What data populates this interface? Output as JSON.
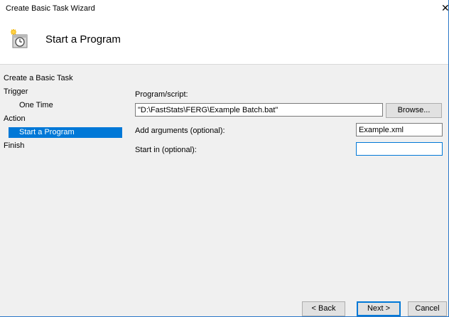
{
  "window": {
    "title": "Create Basic Task Wizard",
    "close_glyph": "✕"
  },
  "header": {
    "title": "Start a Program",
    "icon": "task-scheduler-clock-icon"
  },
  "steps": [
    {
      "label": "Create a Basic Task",
      "level": 0,
      "selected": false
    },
    {
      "label": "Trigger",
      "level": 0,
      "selected": false
    },
    {
      "label": "One Time",
      "level": 1,
      "selected": false
    },
    {
      "label": "Action",
      "level": 0,
      "selected": false
    },
    {
      "label": "Start a Program",
      "level": 1,
      "selected": true
    },
    {
      "label": "Finish",
      "level": 0,
      "selected": false
    }
  ],
  "form": {
    "program_label": "Program/script:",
    "program_value": "\"D:\\FastStats\\FERG\\Example Batch.bat\"",
    "browse_label": "Browse...",
    "arguments_label": "Add arguments (optional):",
    "arguments_value": "Example.xml",
    "startin_label": "Start in (optional):",
    "startin_value": ""
  },
  "footer": {
    "back_label": "< Back",
    "next_label": "Next >",
    "cancel_label": "Cancel"
  },
  "colors": {
    "selection": "#0078d7",
    "focus_border": "#0078d7",
    "window_border": "#2b78c8"
  }
}
